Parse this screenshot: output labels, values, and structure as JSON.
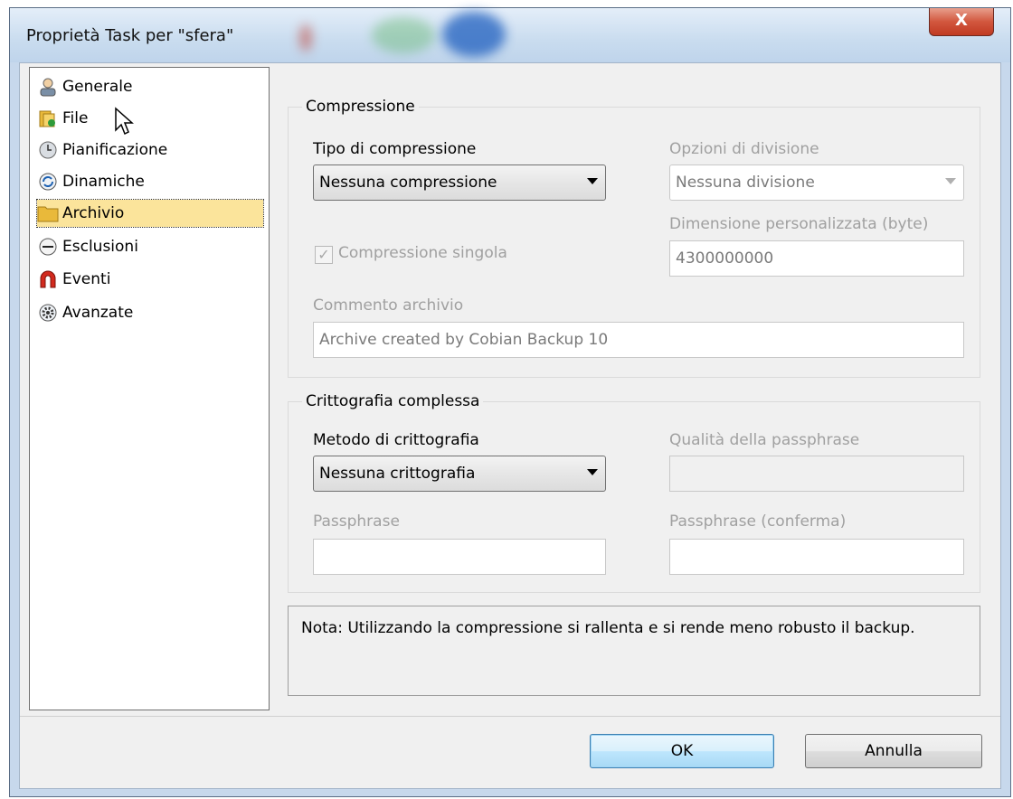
{
  "window": {
    "title": "Proprietà Task per \"sfera\"",
    "close_label": "X"
  },
  "sidebar": {
    "items": [
      {
        "label": "Generale",
        "icon": "user-icon"
      },
      {
        "label": "File",
        "icon": "folder-icon"
      },
      {
        "label": "Pianificazione",
        "icon": "clock-icon"
      },
      {
        "label": "Dinamiche",
        "icon": "refresh-icon"
      },
      {
        "label": "Archivio",
        "icon": "archive-folder-icon"
      },
      {
        "label": "Esclusioni",
        "icon": "minus-icon"
      },
      {
        "label": "Eventi",
        "icon": "magnet-icon"
      },
      {
        "label": "Avanzate",
        "icon": "gear-icon"
      }
    ],
    "selected_index": 4
  },
  "compression": {
    "group_title": "Compressione",
    "type_label": "Tipo di compressione",
    "type_value": "Nessuna compressione",
    "split_label": "Opzioni di divisione",
    "split_value": "Nessuna divisione",
    "custom_size_label": "Dimensione personalizzata (byte)",
    "custom_size_value": "4300000000",
    "single_label": "Compressione singola",
    "comment_label": "Commento archivio",
    "comment_value": "Archive created by Cobian Backup 10"
  },
  "encryption": {
    "group_title": "Crittografia complessa",
    "method_label": "Metodo di crittografia",
    "method_value": "Nessuna crittografia",
    "quality_label": "Qualità della passphrase",
    "passphrase_label": "Passphrase",
    "passphrase_confirm_label": "Passphrase (conferma)"
  },
  "note": "Nota: Utilizzando la compressione si rallenta e si rende meno robusto il backup.",
  "buttons": {
    "ok": "OK",
    "cancel": "Annulla"
  }
}
